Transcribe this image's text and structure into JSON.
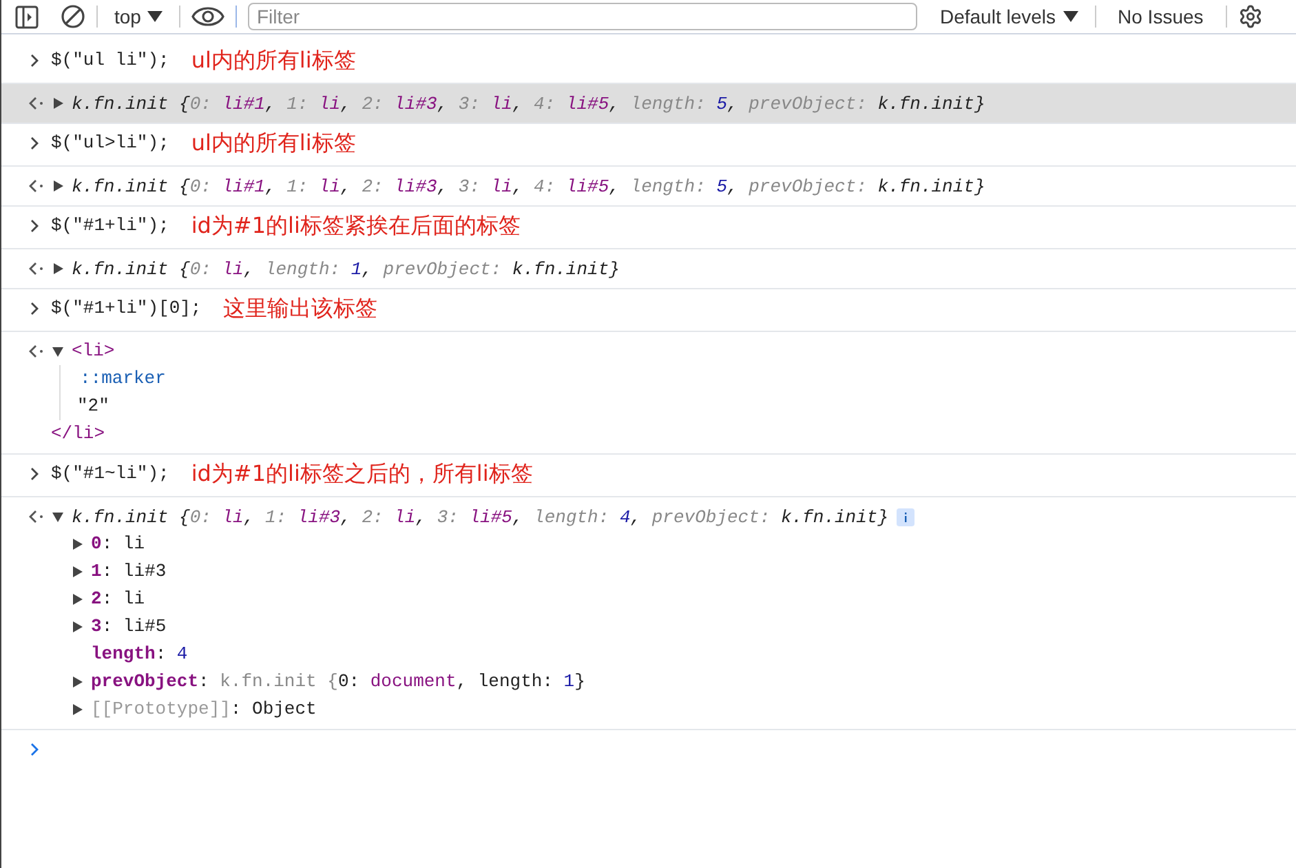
{
  "toolbar": {
    "context": "top",
    "filter": {
      "placeholder": "Filter"
    },
    "levels": "Default levels",
    "issues": "No Issues"
  },
  "entries": [
    {
      "kind": "input",
      "code": "$(\"ul li\");",
      "note": "ul内的所有li标签"
    },
    {
      "kind": "object",
      "selected": true,
      "expanded": false,
      "summary": [
        {
          "kind": "plain",
          "text": "k.fn.init {"
        },
        {
          "kind": "key",
          "text": "0:"
        },
        {
          "kind": "el",
          "text": " li#1"
        },
        {
          "kind": "plain",
          "text": ", "
        },
        {
          "kind": "key",
          "text": "1:"
        },
        {
          "kind": "el",
          "text": " li"
        },
        {
          "kind": "plain",
          "text": ", "
        },
        {
          "kind": "key",
          "text": "2:"
        },
        {
          "kind": "el",
          "text": " li#3"
        },
        {
          "kind": "plain",
          "text": ", "
        },
        {
          "kind": "key",
          "text": "3:"
        },
        {
          "kind": "el",
          "text": " li"
        },
        {
          "kind": "plain",
          "text": ", "
        },
        {
          "kind": "key",
          "text": "4:"
        },
        {
          "kind": "el",
          "text": " li#5"
        },
        {
          "kind": "plain",
          "text": ", "
        },
        {
          "kind": "dim",
          "text": "length:"
        },
        {
          "kind": "num",
          "text": " 5"
        },
        {
          "kind": "plain",
          "text": ", "
        },
        {
          "kind": "dim",
          "text": "prevObject:"
        },
        {
          "kind": "plain",
          "text": " k.fn.init}"
        }
      ]
    },
    {
      "kind": "input",
      "code": "$(\"ul>li\");",
      "note": "ul内的所有li标签"
    },
    {
      "kind": "object",
      "selected": false,
      "expanded": false,
      "summary": [
        {
          "kind": "plain",
          "text": "k.fn.init {"
        },
        {
          "kind": "key",
          "text": "0:"
        },
        {
          "kind": "el",
          "text": " li#1"
        },
        {
          "kind": "plain",
          "text": ", "
        },
        {
          "kind": "key",
          "text": "1:"
        },
        {
          "kind": "el",
          "text": " li"
        },
        {
          "kind": "plain",
          "text": ", "
        },
        {
          "kind": "key",
          "text": "2:"
        },
        {
          "kind": "el",
          "text": " li#3"
        },
        {
          "kind": "plain",
          "text": ", "
        },
        {
          "kind": "key",
          "text": "3:"
        },
        {
          "kind": "el",
          "text": " li"
        },
        {
          "kind": "plain",
          "text": ", "
        },
        {
          "kind": "key",
          "text": "4:"
        },
        {
          "kind": "el",
          "text": " li#5"
        },
        {
          "kind": "plain",
          "text": ", "
        },
        {
          "kind": "dim",
          "text": "length:"
        },
        {
          "kind": "num",
          "text": " 5"
        },
        {
          "kind": "plain",
          "text": ", "
        },
        {
          "kind": "dim",
          "text": "prevObject:"
        },
        {
          "kind": "plain",
          "text": " k.fn.init}"
        }
      ]
    },
    {
      "kind": "input",
      "code": "$(\"#1+li\");",
      "note": "id为#1的li标签紧挨在后面的标签"
    },
    {
      "kind": "object",
      "selected": false,
      "expanded": false,
      "summary": [
        {
          "kind": "plain",
          "text": "k.fn.init {"
        },
        {
          "kind": "key",
          "text": "0:"
        },
        {
          "kind": "el",
          "text": " li"
        },
        {
          "kind": "plain",
          "text": ", "
        },
        {
          "kind": "dim",
          "text": "length:"
        },
        {
          "kind": "num",
          "text": " 1"
        },
        {
          "kind": "plain",
          "text": ", "
        },
        {
          "kind": "dim",
          "text": "prevObject:"
        },
        {
          "kind": "plain",
          "text": " k.fn.init}"
        }
      ]
    },
    {
      "kind": "input",
      "code": "$(\"#1+li\")[0];",
      "note": "这里输出该标签"
    },
    {
      "kind": "element",
      "expanded": true,
      "open_tag": "<li>",
      "children": [
        {
          "kind": "pseudo",
          "text": "::marker"
        },
        {
          "kind": "text",
          "text": "\"2\""
        }
      ],
      "close_tag": "</li>"
    },
    {
      "kind": "input",
      "code": "$(\"#1~li\");",
      "note": "id为#1的li标签之后的，所有li标签"
    },
    {
      "kind": "object",
      "selected": false,
      "expanded": true,
      "info_badge": true,
      "summary": [
        {
          "kind": "plain",
          "text": "k.fn.init {"
        },
        {
          "kind": "key",
          "text": "0:"
        },
        {
          "kind": "el",
          "text": " li"
        },
        {
          "kind": "plain",
          "text": ", "
        },
        {
          "kind": "key",
          "text": "1:"
        },
        {
          "kind": "el",
          "text": " li#3"
        },
        {
          "kind": "plain",
          "text": ", "
        },
        {
          "kind": "key",
          "text": "2:"
        },
        {
          "kind": "el",
          "text": " li"
        },
        {
          "kind": "plain",
          "text": ", "
        },
        {
          "kind": "key",
          "text": "3:"
        },
        {
          "kind": "el",
          "text": " li#5"
        },
        {
          "kind": "plain",
          "text": ", "
        },
        {
          "kind": "dim",
          "text": "length:"
        },
        {
          "kind": "num",
          "text": " 4"
        },
        {
          "kind": "plain",
          "text": ", "
        },
        {
          "kind": "dim",
          "text": "prevObject:"
        },
        {
          "kind": "plain",
          "text": " k.fn.init}"
        }
      ],
      "properties": [
        {
          "key": "0",
          "internal": false,
          "expandable": true,
          "value": [
            {
              "kind": "plain",
              "text": ": li"
            }
          ]
        },
        {
          "key": "1",
          "internal": false,
          "expandable": true,
          "value": [
            {
              "kind": "plain",
              "text": ": li#3"
            }
          ]
        },
        {
          "key": "2",
          "internal": false,
          "expandable": true,
          "value": [
            {
              "kind": "plain",
              "text": ": li"
            }
          ]
        },
        {
          "key": "3",
          "internal": false,
          "expandable": true,
          "value": [
            {
              "kind": "plain",
              "text": ": li#5"
            }
          ]
        },
        {
          "key": "length",
          "internal": false,
          "expandable": false,
          "value": [
            {
              "kind": "plain",
              "text": ": "
            },
            {
              "kind": "num",
              "text": "4"
            }
          ]
        },
        {
          "key": "prevObject",
          "internal": false,
          "expandable": true,
          "value": [
            {
              "kind": "plain",
              "text": ": "
            },
            {
              "kind": "dim",
              "text": "k.fn.init {"
            },
            {
              "kind": "plain",
              "text": "0:"
            },
            {
              "kind": "el",
              "text": " document"
            },
            {
              "kind": "plain",
              "text": ", length:"
            },
            {
              "kind": "num",
              "text": " 1"
            },
            {
              "kind": "plain",
              "text": "}"
            }
          ]
        },
        {
          "key": "[[Prototype]]",
          "internal": true,
          "expandable": true,
          "value": [
            {
              "kind": "plain",
              "text": ": Object"
            }
          ]
        }
      ]
    }
  ]
}
